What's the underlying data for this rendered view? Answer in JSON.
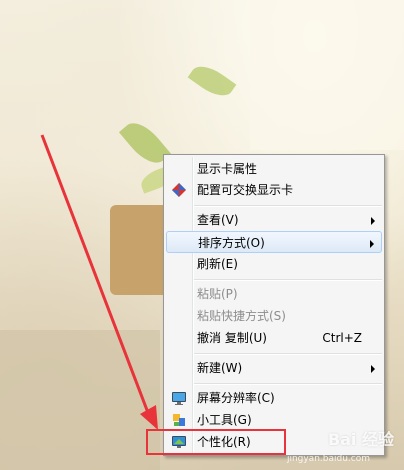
{
  "menu": {
    "items": [
      {
        "label": "显示卡属性",
        "disabled": false
      },
      {
        "label": "配置可交换显示卡",
        "disabled": false,
        "icon": "graphics-switch-icon"
      },
      {
        "label": "查看(V)",
        "submenu": true
      },
      {
        "label": "排序方式(O)",
        "submenu": true,
        "highlighted": true
      },
      {
        "label": "刷新(E)"
      },
      {
        "label": "粘贴(P)",
        "disabled": true
      },
      {
        "label": "粘贴快捷方式(S)",
        "disabled": true
      },
      {
        "label": "撤消 复制(U)",
        "shortcut": "Ctrl+Z"
      },
      {
        "label": "新建(W)",
        "submenu": true
      },
      {
        "label": "屏幕分辨率(C)",
        "icon": "monitor-icon"
      },
      {
        "label": "小工具(G)",
        "icon": "gadgets-icon"
      },
      {
        "label": "个性化(R)",
        "icon": "personalize-icon"
      }
    ]
  },
  "watermark": {
    "brand": "Bai 经验",
    "url": "jingyan.baidu.com"
  },
  "colors": {
    "annotation_red": "#e8333a",
    "menu_bg": "#f5f5f5",
    "highlight_border": "#aecff7"
  }
}
